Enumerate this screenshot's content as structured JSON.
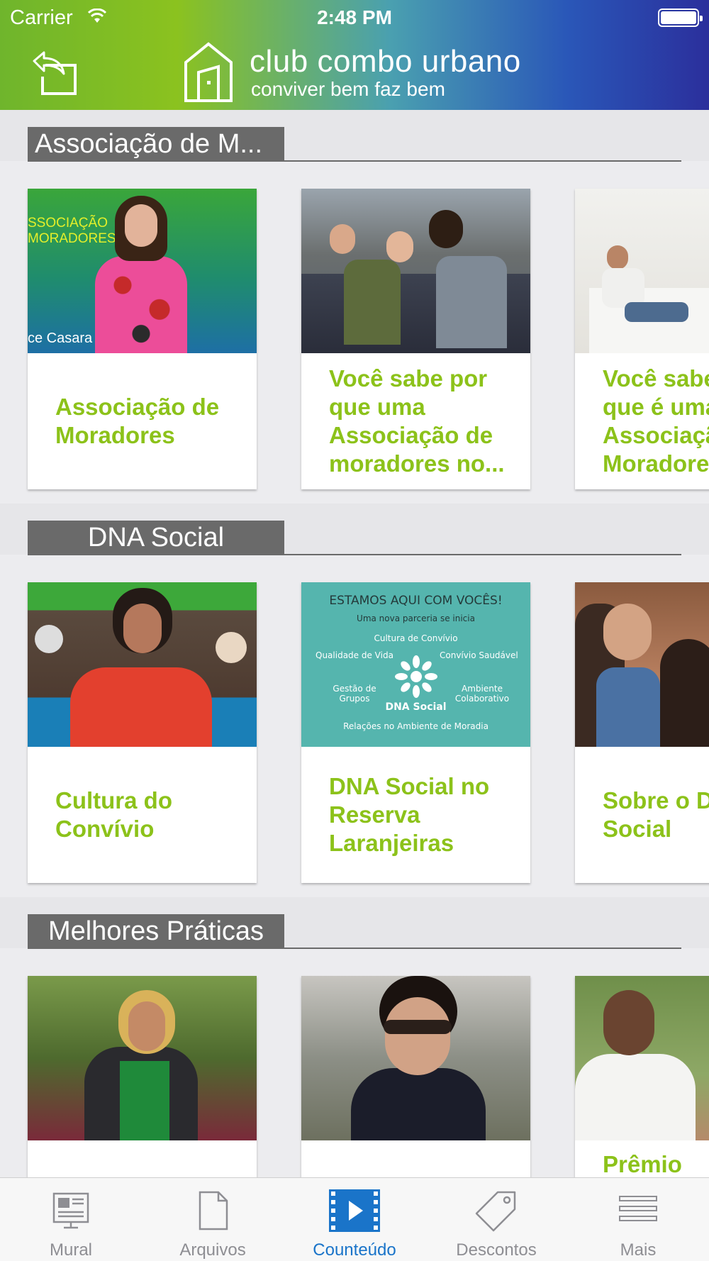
{
  "status_bar": {
    "carrier": "Carrier",
    "time": "2:48 PM"
  },
  "header": {
    "brand_title": "club combo urbano",
    "brand_subtitle": "conviver bem faz bem",
    "back_icon": "back-arrow-icon",
    "logo_icon": "house-logo-icon"
  },
  "sections": [
    {
      "label": "Associação de M...",
      "cards": [
        {
          "title": "Associação de\nMoradores",
          "thumb_text_1": "SSOCIAÇÃO",
          "thumb_text_2": "MORADORES",
          "thumb_text_3": "ce Casara"
        },
        {
          "title": "Você sabe por\nque uma\nAssociação de\nmoradores no..."
        },
        {
          "title": "Você sabe\nque é uma\nAssociação\nMoradores"
        }
      ]
    },
    {
      "label": "DNA Social",
      "cards": [
        {
          "title": "Cultura do\nConvívio"
        },
        {
          "title": "DNA Social no\nReserva\nLaranjeiras",
          "thumb_heading": "ESTAMOS AQUI COM VOCÊS!",
          "thumb_sub": "Uma nova parceria se inicia",
          "thumb_items": [
            "Cultura de Convívio",
            "Qualidade de Vida",
            "Convívio Saudável",
            "Gestão de Grupos",
            "Ambiente Colaborativo",
            "Relações no Ambiente de Moradia"
          ],
          "thumb_logo": "DNA Social"
        },
        {
          "title": "Sobre o D\nSocial"
        }
      ]
    },
    {
      "label": "Melhores Práticas",
      "cards": [
        {
          "title": ""
        },
        {
          "title": ""
        },
        {
          "title": "Prêmio"
        }
      ]
    }
  ],
  "tabbar": {
    "items": [
      {
        "label": "Mural",
        "icon": "newspaper-icon",
        "active": false
      },
      {
        "label": "Arquivos",
        "icon": "document-icon",
        "active": false
      },
      {
        "label": "Counteúdo",
        "icon": "video-play-icon",
        "active": true
      },
      {
        "label": "Descontos",
        "icon": "tag-icon",
        "active": false
      },
      {
        "label": "Mais",
        "icon": "menu-lines-icon",
        "active": false
      }
    ]
  },
  "colors": {
    "accent_green": "#8cc21a",
    "tab_active": "#1a74c9",
    "section_label_bg": "#6a6a6a"
  }
}
